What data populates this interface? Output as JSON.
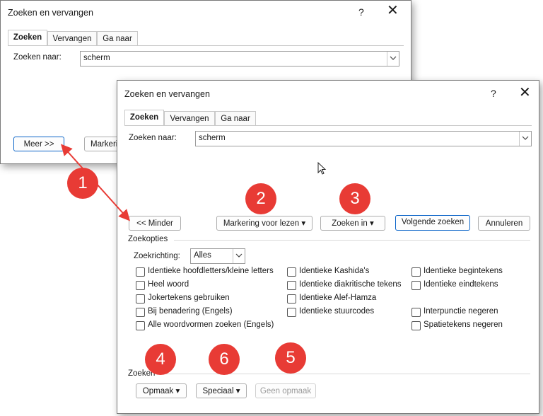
{
  "back_dialog": {
    "title": "Zoeken en vervangen",
    "help": "?",
    "close": "✕",
    "tabs": [
      "Zoeken",
      "Vervangen",
      "Ga naar"
    ],
    "find_label": "Zoeken naar:",
    "find_value": "scherm",
    "more_button": "Meer >>",
    "marking_button": "Markeri"
  },
  "front_dialog": {
    "title": "Zoeken en vervangen",
    "help": "?",
    "close": "✕",
    "tabs": [
      "Zoeken",
      "Vervangen",
      "Ga naar"
    ],
    "find_label": "Zoeken naar:",
    "find_value": "scherm",
    "buttons": {
      "less": "<< Minder",
      "reading_highlight": "Markering voor lezen ▾",
      "find_in": "Zoeken in ▾",
      "find_next": "Volgende zoeken",
      "cancel": "Annuleren"
    },
    "options_title": "Zoekopties",
    "direction_label": "Zoekrichting:",
    "direction_value": "Alles",
    "checkboxes_col1": [
      "Identieke hoofdletters/kleine letters",
      "Heel woord",
      "Jokertekens gebruiken",
      "Bij benadering (Engels)",
      "Alle woordvormen zoeken (Engels)"
    ],
    "checkboxes_col2": [
      "Identieke Kashida's",
      "Identieke diakritische tekens",
      "Identieke Alef-Hamza",
      "Identieke stuurcodes"
    ],
    "checkboxes_col3": [
      "Identieke begintekens",
      "Identieke eindtekens",
      "Interpunctie negeren",
      "Spatietekens negeren"
    ],
    "find_section_title": "Zoeken",
    "format_button": "Opmaak ▾",
    "special_button": "Speciaal ▾",
    "no_format_button": "Geen opmaak"
  },
  "badges": [
    "1",
    "2",
    "3",
    "4",
    "6",
    "5"
  ],
  "colors": {
    "badge": "#e83b35",
    "arrow": "#e83b35",
    "primary_border": "#0a64c8"
  }
}
